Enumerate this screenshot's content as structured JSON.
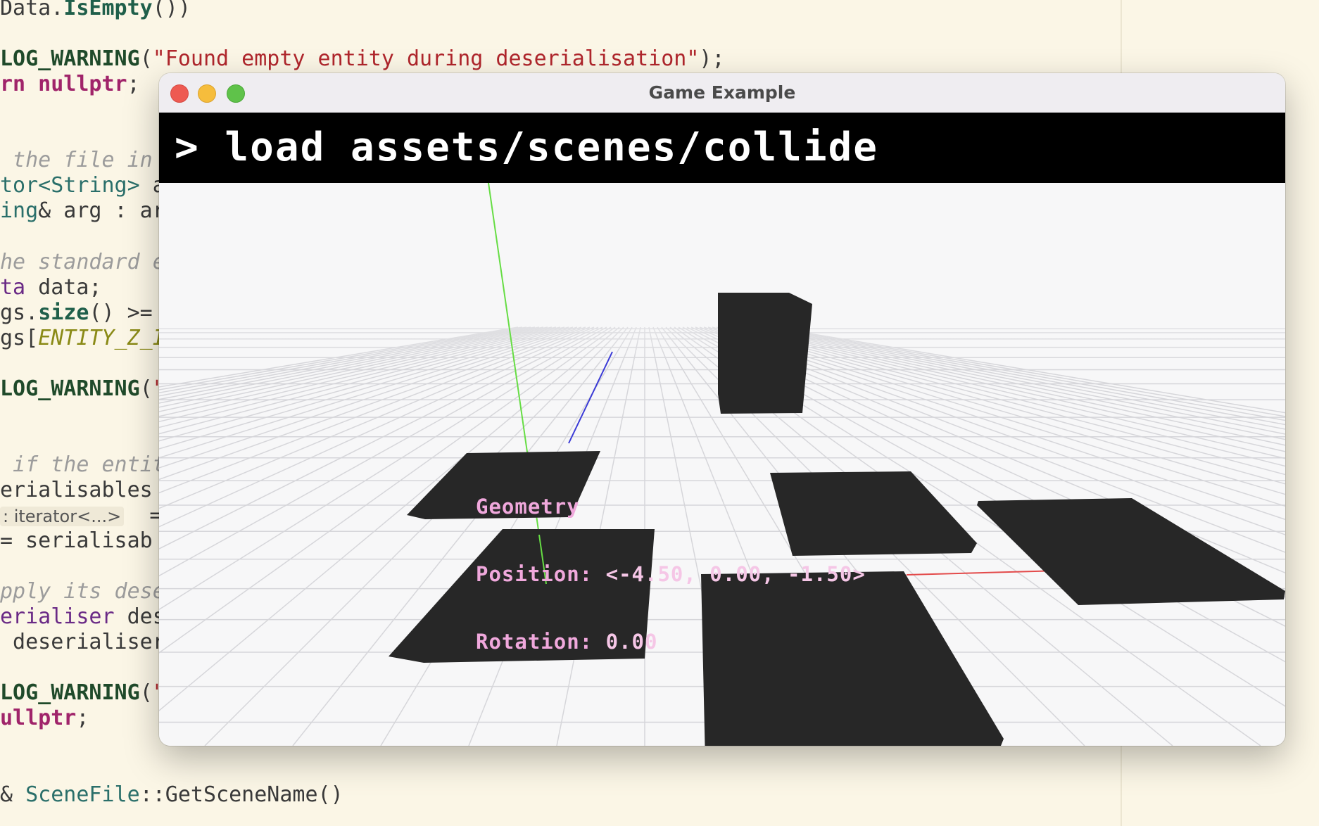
{
  "editor": {
    "lines": [
      [
        {
          "c": "c-plain",
          "t": "Data."
        },
        {
          "c": "c-fn",
          "t": "IsEmpty"
        },
        {
          "c": "c-plain",
          "t": "())"
        }
      ],
      [],
      [
        {
          "c": "c-mac",
          "t": "LOG_WARNING"
        },
        {
          "c": "c-plain",
          "t": "("
        },
        {
          "c": "c-str",
          "t": "\"Found empty entity during deserialisation\""
        },
        {
          "c": "c-plain",
          "t": ");"
        }
      ],
      [
        {
          "c": "c-kw",
          "t": "rn nullptr"
        },
        {
          "c": "c-plain",
          "t": ";"
        }
      ],
      [],
      [],
      [
        {
          "c": "c-cmt",
          "t": " the file in"
        }
      ],
      [
        {
          "c": "c-type",
          "t": "tor<String>"
        },
        {
          "c": "c-plain",
          "t": " a"
        }
      ],
      [
        {
          "c": "c-type",
          "t": "ing"
        },
        {
          "c": "c-plain",
          "t": "& arg : ar"
        }
      ],
      [],
      [
        {
          "c": "c-cmt",
          "t": "he standard e"
        }
      ],
      [
        {
          "c": "c-var",
          "t": "ta"
        },
        {
          "c": "c-plain",
          "t": " data;"
        }
      ],
      [
        {
          "c": "c-plain",
          "t": "gs."
        },
        {
          "c": "c-fn",
          "t": "size"
        },
        {
          "c": "c-plain",
          "t": "() >="
        }
      ],
      [
        {
          "c": "c-plain",
          "t": "gs["
        },
        {
          "c": "c-const",
          "t": "ENTITY_Z_I"
        }
      ],
      [],
      [
        {
          "c": "c-mac",
          "t": "LOG_WARNING"
        },
        {
          "c": "c-plain",
          "t": "("
        },
        {
          "c": "c-str",
          "t": "\"F"
        }
      ],
      [],
      [],
      [
        {
          "c": "c-cmt",
          "t": " if the entit"
        }
      ],
      [
        {
          "c": "c-plain",
          "t": "erialisables"
        }
      ],
      [
        {
          "c": "c-hint",
          "t": ": iterator<...>"
        },
        {
          "c": "c-plain",
          "t": "  ="
        }
      ],
      [
        {
          "c": "c-plain",
          "t": "= serialisab"
        }
      ],
      [],
      [
        {
          "c": "c-cmt",
          "t": "pply its dese"
        }
      ],
      [
        {
          "c": "c-var",
          "t": "erialiser"
        },
        {
          "c": "c-plain",
          "t": " dese"
        }
      ],
      [
        {
          "c": "c-plain",
          "t": " deserialiser"
        }
      ],
      [],
      [
        {
          "c": "c-mac",
          "t": "LOG_WARNING"
        },
        {
          "c": "c-plain",
          "t": "("
        },
        {
          "c": "c-str",
          "t": "\""
        }
      ],
      [
        {
          "c": "c-kw",
          "t": "ullptr"
        },
        {
          "c": "c-plain",
          "t": ";"
        }
      ],
      [],
      [],
      [
        {
          "c": "c-plain",
          "t": "& "
        },
        {
          "c": "c-type",
          "t": "SceneFile"
        },
        {
          "c": "c-plain",
          "t": "::GetSceneName()"
        }
      ]
    ]
  },
  "window": {
    "title": "Game Example",
    "console": "> load assets/scenes/collide",
    "overlay": {
      "heading": "Geometry",
      "position_label": "Position:",
      "position_value": "<-4.50, 0.00, -1.50>",
      "rotation_label": "Rotation:",
      "rotation_value": "0.00"
    }
  },
  "colors": {
    "object_fill": "#272727",
    "grid": "#d9d9dc",
    "axis_y": "#66dd44",
    "axis_z": "#3a3ad6",
    "axis_x": "#e34a4a"
  }
}
